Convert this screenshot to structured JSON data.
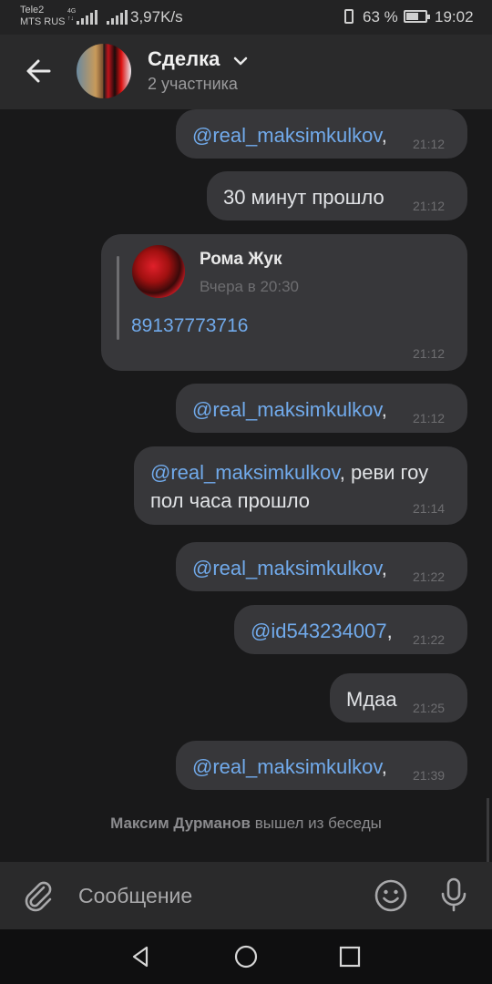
{
  "status_bar": {
    "carrier1": "Tele2",
    "carrier2": "MTS RUS",
    "net_type": "4G",
    "net_dir": "↑↓",
    "speed": "3,97K/s",
    "battery_pct": "63 %",
    "battery_level": 0.63,
    "time": "19:02"
  },
  "header": {
    "title": "Сделка",
    "subtitle": "2 участника"
  },
  "messages": [
    {
      "text": "",
      "mention": "@real_maksimkulkov",
      "suffix": ",",
      "time": "21:12"
    },
    {
      "text": "30 минут прошло",
      "time": "21:12"
    },
    {
      "quote": {
        "name": "Рома Жук",
        "date": "Вчера в 20:30",
        "phone": "89137773716"
      },
      "time": "21:12"
    },
    {
      "mention": "@real_maksimkulkov",
      "suffix": ",",
      "time": "21:12"
    },
    {
      "mention": "@real_maksimkulkov",
      "line1_rest": ", реви гоу",
      "line2": "пол часа прошло",
      "time": "21:14"
    },
    {
      "mention": "@real_maksimkulkov",
      "suffix": ",",
      "time": "21:22"
    },
    {
      "mention": "@id543234007",
      "suffix": ",",
      "time": "21:22"
    },
    {
      "text": "Мдаа",
      "time": "21:25"
    },
    {
      "mention": "@real_maksimkulkov",
      "suffix": ",",
      "time": "21:39"
    }
  ],
  "service_message": {
    "actor": "Максим Дурманов",
    "action": "вышел из беседы"
  },
  "composer": {
    "placeholder": "Сообщение"
  },
  "icons": {
    "back": "arrow-left-icon",
    "dropdown": "chevron-down-icon",
    "attach": "paperclip-icon",
    "emoji": "smile-icon",
    "voice": "microphone-icon",
    "nav": [
      "triangle-back-icon",
      "circle-home-icon",
      "square-recents-icon"
    ]
  },
  "colors": {
    "accent": "#71aaeb",
    "bubble": "#37373a",
    "background": "#19191a"
  }
}
